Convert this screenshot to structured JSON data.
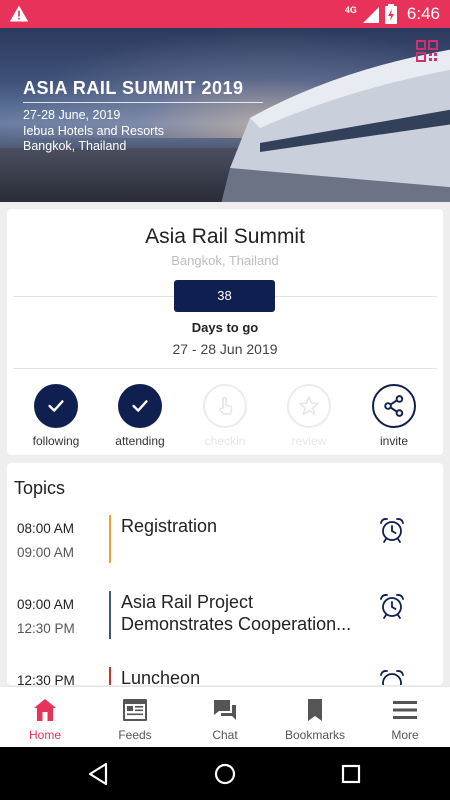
{
  "status_bar": {
    "network": "4G",
    "time": "6:46",
    "icons": [
      "warning-icon",
      "signal-icon",
      "battery-charging-icon"
    ]
  },
  "banner": {
    "title": "ASIA RAIL SUMMIT 2019",
    "date_line": "27-28 June, 2019",
    "venue_line": "Iebua Hotels and Resorts",
    "city_line": "Bangkok, Thailand",
    "qr_icon": "qr-code-icon"
  },
  "event": {
    "name": "Asia Rail Summit",
    "location": "Bangkok, Thailand",
    "days_count": "38",
    "days_label": "Days to go",
    "date_range": "27 - 28 Jun 2019"
  },
  "actions": [
    {
      "label": "following",
      "icon": "check-icon",
      "state": "active"
    },
    {
      "label": "attending",
      "icon": "check-icon",
      "state": "active"
    },
    {
      "label": "checkin",
      "icon": "tap-hand-icon",
      "state": "disabled"
    },
    {
      "label": "review",
      "icon": "star-icon",
      "state": "disabled"
    },
    {
      "label": "invite",
      "icon": "share-icon",
      "state": "outline"
    }
  ],
  "topics": {
    "heading": "Topics",
    "items": [
      {
        "start": "08:00 AM",
        "end": "09:00 AM",
        "title": "Registration",
        "subtitle": "",
        "color": "#f0a030"
      },
      {
        "start": "09:00 AM",
        "end": "12:30 PM",
        "title": "Asia Rail Project",
        "subtitle": "Demonstrates Cooperation...",
        "color": "#3a5a78"
      },
      {
        "start": "12:30 PM",
        "end": "",
        "title": "Luncheon",
        "subtitle": "",
        "color": "#c0392b"
      }
    ]
  },
  "bottom_nav": [
    {
      "label": "Home",
      "icon": "home-icon",
      "active": true
    },
    {
      "label": "Feeds",
      "icon": "feeds-icon",
      "active": false
    },
    {
      "label": "Chat",
      "icon": "chat-icon",
      "active": false
    },
    {
      "label": "Bookmarks",
      "icon": "bookmark-icon",
      "active": false
    },
    {
      "label": "More",
      "icon": "menu-icon",
      "active": false
    }
  ],
  "colors": {
    "accent": "#e8325a",
    "primary": "#0f2050"
  }
}
